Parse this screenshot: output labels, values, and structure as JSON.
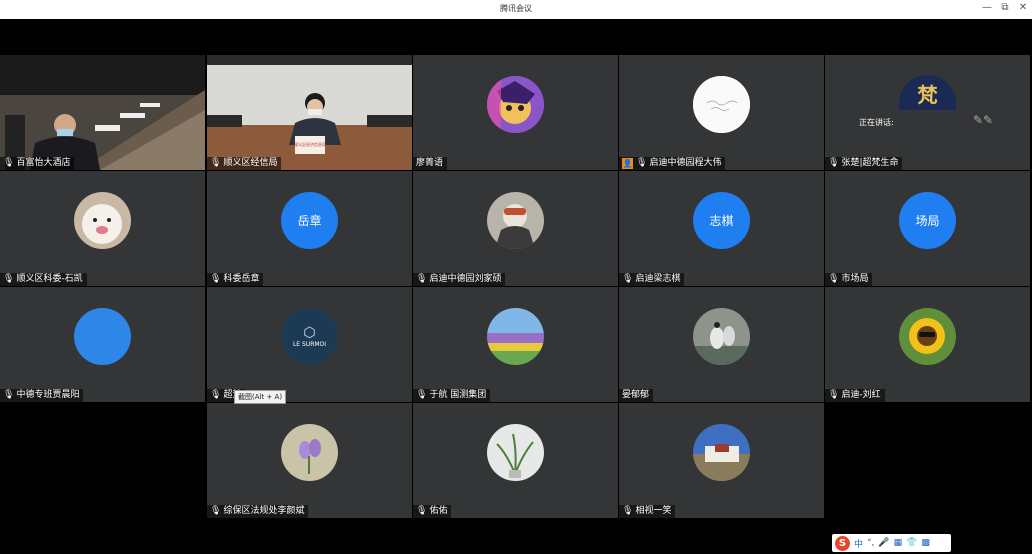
{
  "window": {
    "title": "腾讯会议",
    "minimize": "—",
    "restore": "⧉",
    "close": "✕"
  },
  "participants": [
    {
      "name": "百富怡大酒店"
    },
    {
      "name": "顺义区经信局",
      "placard": "顺义区经济信息局"
    },
    {
      "name": "廖菁语"
    },
    {
      "name": "启迪中德园程大伟"
    },
    {
      "name": "张楚|超梵生命",
      "speaking_label": "正在讲话:"
    },
    {
      "name": "顺义区科委-石凯"
    },
    {
      "name": "科委岳章",
      "avatar_text": "岳章"
    },
    {
      "name": "启迪中德园刘家硕"
    },
    {
      "name": "启迪梁志棋",
      "avatar_text": "志棋"
    },
    {
      "name": "市场局",
      "avatar_text": "场局"
    },
    {
      "name": "中德专班贾晨阳"
    },
    {
      "name": "超梵",
      "avatar_text": "LE SURMOI"
    },
    {
      "name": "于航 国测集团"
    },
    {
      "name": "晏郁郁"
    },
    {
      "name": "启迪-刘红"
    },
    {
      "name": "综保区法规处李颜斌"
    },
    {
      "name": "佑佑"
    },
    {
      "name": "相视一笑"
    }
  ],
  "tooltip": "截图(Alt + A)",
  "ime": {
    "logo": "S",
    "lang": "中",
    "punct": "°,",
    "mic": "🎤",
    "keyboard": "▦",
    "skin": "👕",
    "tools": "▩"
  },
  "colors": {
    "blue_avatar": "#1f7ff0",
    "tile_bg": "#333537"
  }
}
